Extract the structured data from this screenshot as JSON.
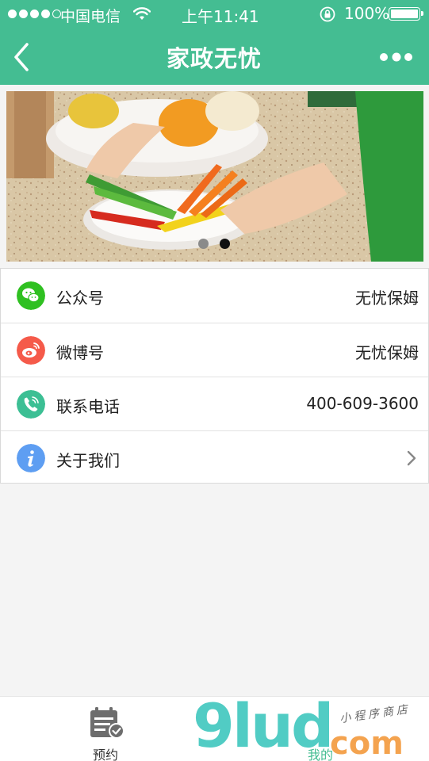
{
  "status_bar": {
    "carrier": "中国电信",
    "time": "上午11:41",
    "battery": "100%",
    "signal_bars": 4
  },
  "nav": {
    "title": "家政无忧",
    "back_icon": "chevron-left-icon",
    "more_icon": "more-dots-icon"
  },
  "banner": {
    "image": "vegetables-cutting-photo",
    "slide_count": 2,
    "active_slide": 2
  },
  "list": [
    {
      "icon": "wechat-icon",
      "color": "#2fc021",
      "label": "公众号",
      "value": "无忧保姆"
    },
    {
      "icon": "weibo-icon",
      "color": "#f55a4a",
      "label": "微博号",
      "value": "无忧保姆"
    },
    {
      "icon": "phone-icon",
      "color": "#3cbf94",
      "label": "联系电话",
      "value": "400-609-3600"
    },
    {
      "icon": "info-icon",
      "color": "#5e9ef2",
      "label": "关于我们",
      "value": ""
    }
  ],
  "tabbar": {
    "tabs": [
      {
        "label": "预约",
        "icon": "calendar-check-icon",
        "active": false
      },
      {
        "label": "我的",
        "icon": "user-icon",
        "active": true
      }
    ]
  },
  "watermark": {
    "text": "9lud",
    "domain": "com",
    "store": "小程序商店"
  },
  "colors": {
    "brand": "#44bd92",
    "active_tab": "#44bd92"
  }
}
